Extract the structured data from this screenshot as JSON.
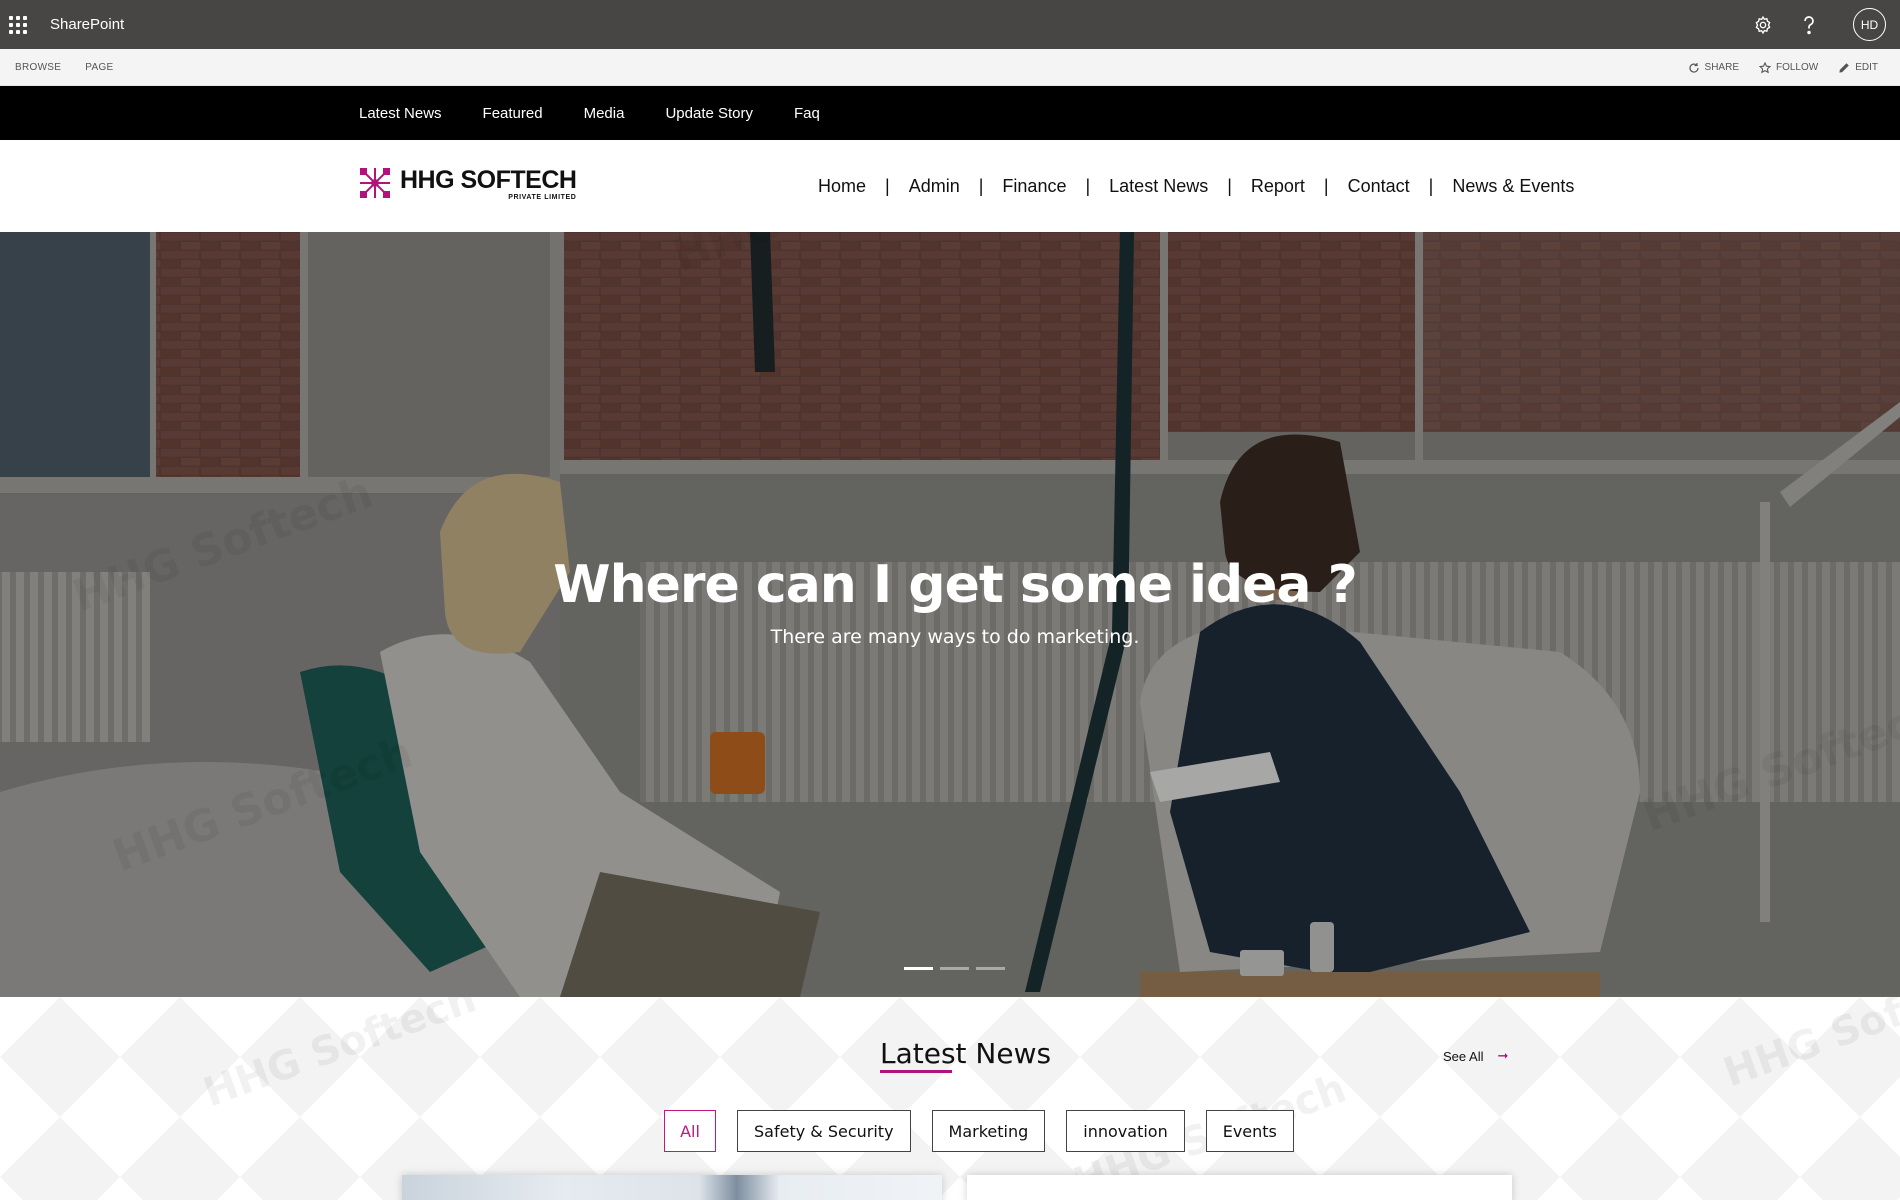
{
  "suite_bar": {
    "app_name": "SharePoint",
    "icons": [
      "app-launcher-icon",
      "settings-gear-icon",
      "help-question-icon"
    ],
    "user_initials": "HD",
    "background": "#484644"
  },
  "ribbon": {
    "tabs": [
      "BROWSE",
      "PAGE"
    ],
    "actions": [
      {
        "label": "SHARE",
        "icon": "share-icon"
      },
      {
        "label": "FOLLOW",
        "icon": "star-icon"
      },
      {
        "label": "EDIT",
        "icon": "pencil-icon"
      }
    ]
  },
  "top_nav": {
    "items": [
      "Latest News",
      "Featured",
      "Media",
      "Update Story",
      "Faq"
    ],
    "background": "#000000"
  },
  "header": {
    "logo_title": "HHG SOFTECH",
    "logo_subtitle": "PRIVATE LIMITED",
    "logo_color": "#b0137a",
    "nav": [
      "Home",
      "Admin",
      "Finance",
      "Latest News",
      "Report",
      "Contact",
      "News & Events"
    ]
  },
  "hero": {
    "title": "Where can I get some idea ?",
    "subtitle": "There are many ways to do  marketing.",
    "slides": 3,
    "active_slide": 1
  },
  "latest_news": {
    "title": "Latest News",
    "see_all": "See All",
    "accent": "#b0137a",
    "filters": [
      "All",
      "Safety & Security",
      "Marketing",
      "innovation",
      "Events"
    ],
    "active_filter": "All"
  }
}
